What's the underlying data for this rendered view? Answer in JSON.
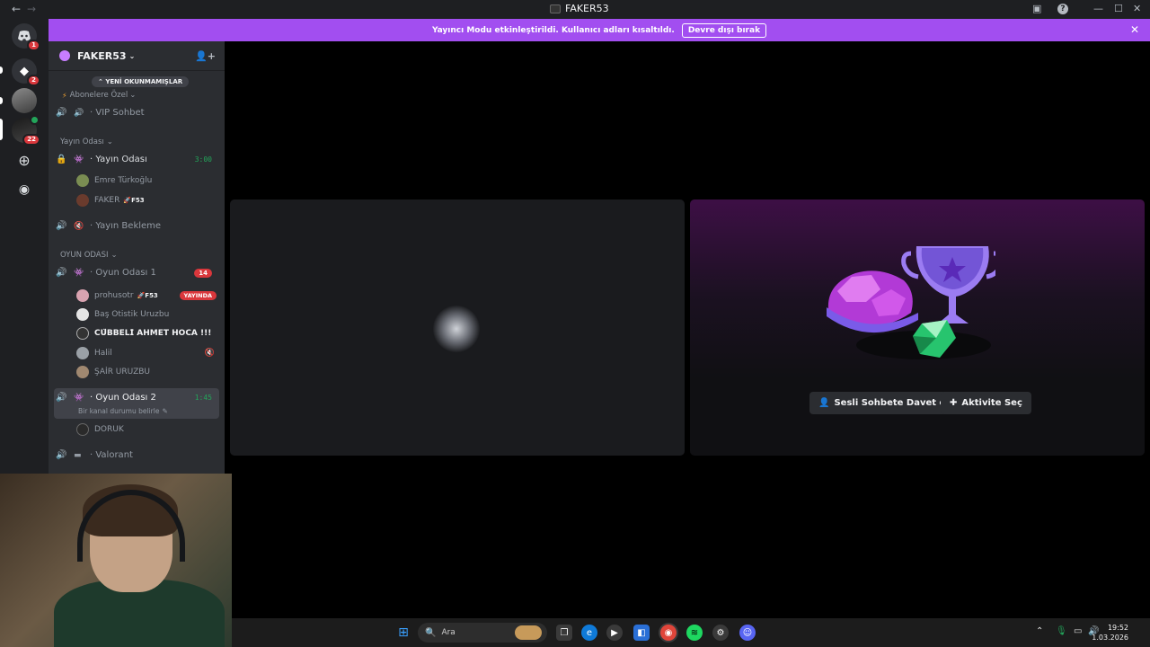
{
  "window": {
    "title": "FAKER53"
  },
  "servers": [
    {
      "name": "discord-home-icon",
      "glyph": "🎮",
      "badge": "1"
    },
    {
      "name": "server-2-icon",
      "glyph": "◆",
      "badge": "2"
    },
    {
      "name": "server-3-icon",
      "glyph": "",
      "badge": ""
    },
    {
      "name": "server-4-icon",
      "glyph": "",
      "badge": "22"
    }
  ],
  "streamer_banner": {
    "text": "Yayıncı Modu etkinleştirildi. Kullanıcı adları kısaltıldı.",
    "button": "Devre dışı bırak"
  },
  "guild": {
    "name": "FAKER53"
  },
  "sidebar": {
    "new_unread": "YENİ OKUNMAMIŞLAR",
    "subscriber_category": "Abonelere Özel",
    "vip_channel": "VIP Sohbet",
    "cat_yayin": "Yayın Odası",
    "yayin_channel": {
      "name": "Yayın Odası",
      "time": "3:00"
    },
    "yayin_users": [
      {
        "name": "Emre Türkoğlu",
        "tag": ""
      },
      {
        "name": "FAKER",
        "tag": "F53"
      }
    ],
    "yayin_bekleme": "Yayın Bekleme",
    "cat_oyun": "OYUN ODASI",
    "oyun1": {
      "name": "Oyun Odası 1",
      "count": "14"
    },
    "oyun1_users": [
      {
        "name": "prohusotr",
        "tag": "F53",
        "live": "YAYINDA"
      },
      {
        "name": "Baş Otistik Uruzbu",
        "tag": "",
        "live": ""
      },
      {
        "name": "𝗖𝗨̈𝗕𝗕𝗘𝗟𝗜̇ 𝗔𝗛𝗠𝗘𝗧 𝗛𝗢𝗖𝗔 !!!",
        "tag": "",
        "live": ""
      },
      {
        "name": "Halil",
        "tag": "",
        "live": ""
      },
      {
        "name": "ŞAİR URUZBU",
        "tag": "",
        "live": ""
      }
    ],
    "oyun2": {
      "name": "Oyun Odası 2",
      "time": "1:45",
      "status": "Bir kanal durumu belirle"
    },
    "oyun2_users": [
      {
        "name": "DORUK"
      }
    ],
    "valorant": "Valorant"
  },
  "activity": {
    "invite_button": "Sesli Sohbete Davet et",
    "activity_button": "Aktivite Seç"
  },
  "taskbar": {
    "search_placeholder": "Ara",
    "time": "19:52",
    "date": "1.03.2026"
  }
}
